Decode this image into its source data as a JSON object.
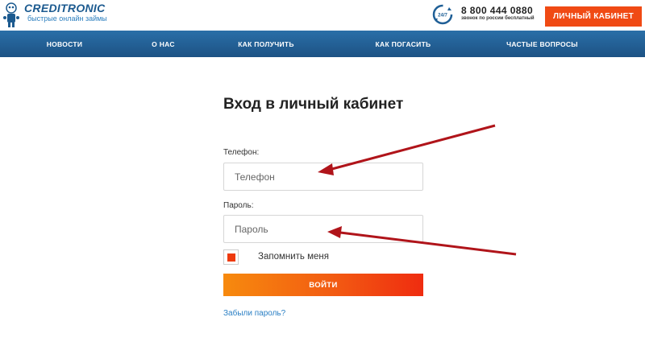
{
  "header": {
    "logo_name": "CREDITRONIC",
    "logo_tagline": "быстрые онлайн займы",
    "clock_badge": "24/7",
    "phone": "8 800 444 0880",
    "phone_note": "звонок по россии бесплатный",
    "cabinet_button": "ЛИЧНЫЙ КАБИНЕТ"
  },
  "nav": {
    "items": [
      {
        "label": "НОВОСТИ"
      },
      {
        "label": "О НАС"
      },
      {
        "label": "КАК ПОЛУЧИТЬ"
      },
      {
        "label": "КАК ПОГАСИТЬ"
      },
      {
        "label": "ЧАСТЫЕ ВОПРОСЫ"
      }
    ]
  },
  "form": {
    "title": "Вход в личный кабинет",
    "phone_label": "Телефон:",
    "phone_placeholder": "Телефон",
    "password_label": "Пароль:",
    "password_placeholder": "Пароль",
    "remember_label": "Запомнить меня",
    "remember_checked": true,
    "submit_label": "ВОЙТИ",
    "forgot_link": "Забыли пароль?"
  },
  "colors": {
    "brand_blue": "#1d5284",
    "accent_orange": "#f04a14",
    "arrow_red": "#b0141a",
    "link_blue": "#2a7fc4"
  }
}
